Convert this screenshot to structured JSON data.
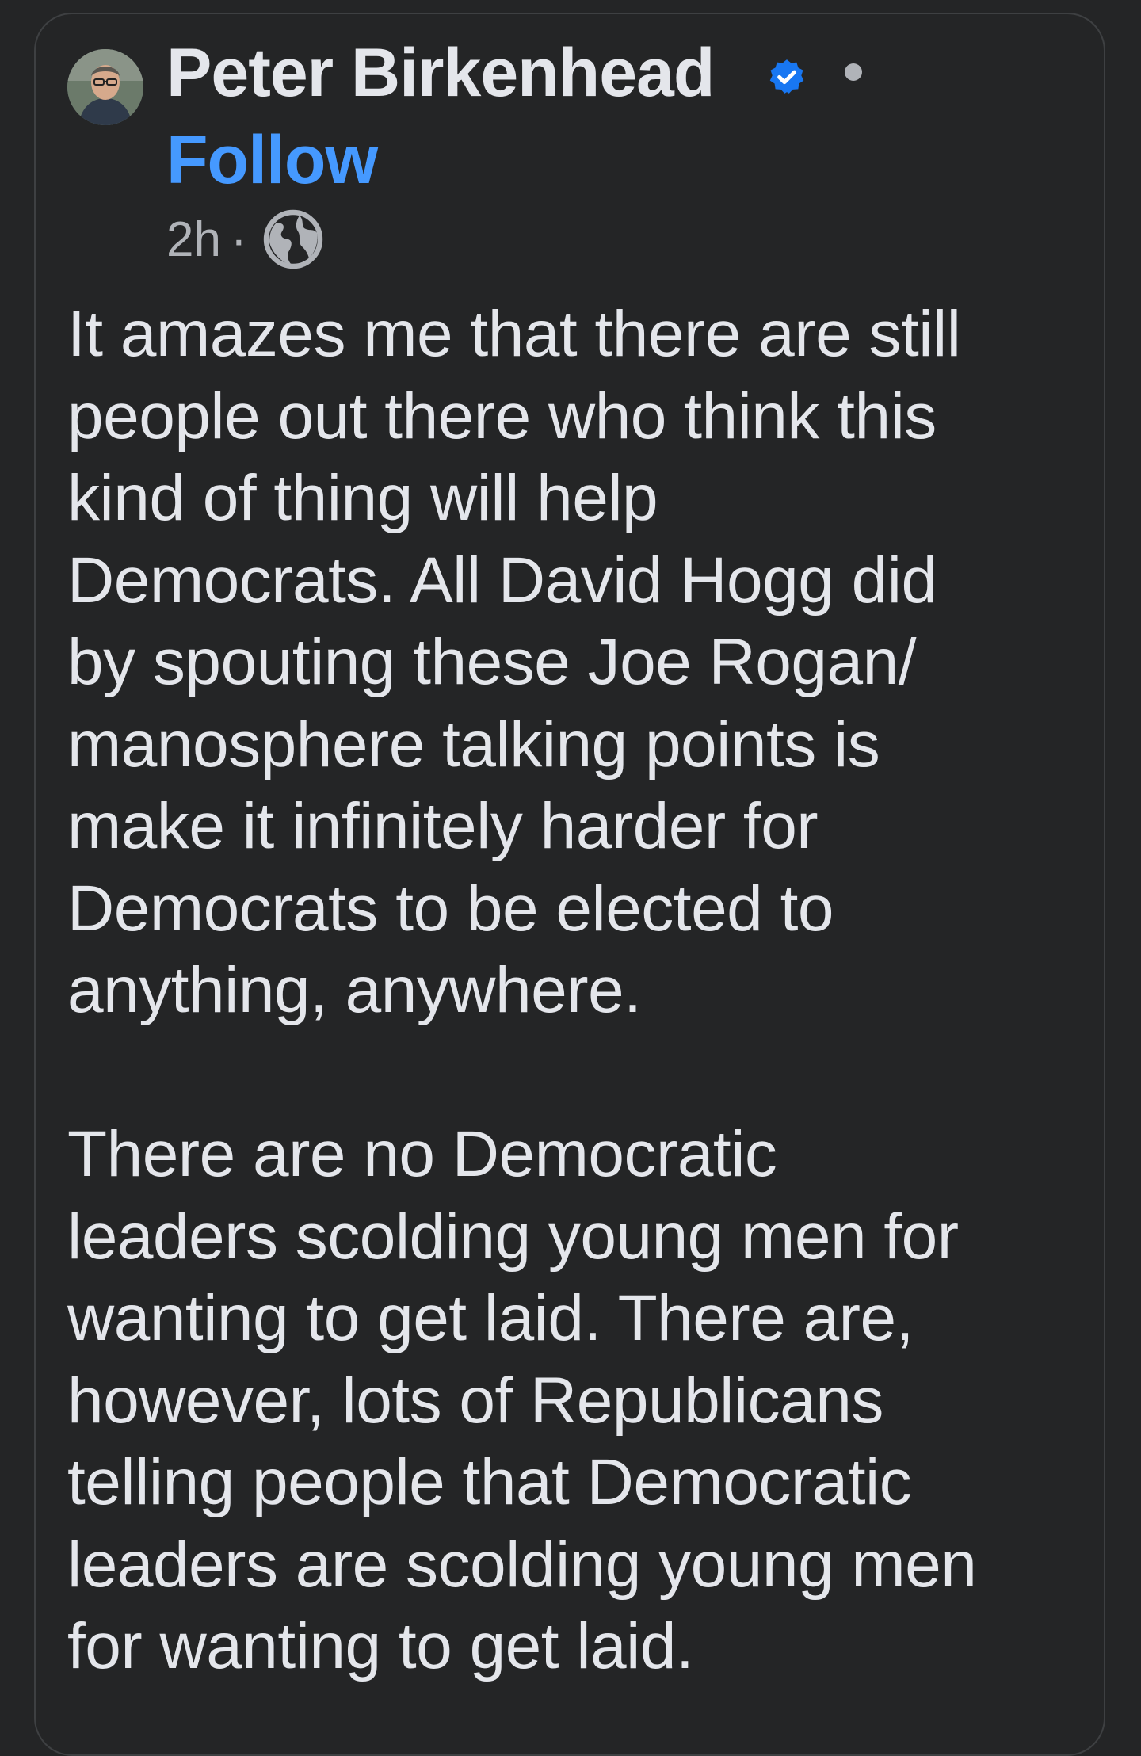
{
  "post": {
    "author": "Peter Birkenhead",
    "follow_label": "Follow",
    "timestamp": "2h",
    "separator": "·",
    "audience_icon": "globe-icon",
    "verified_icon": "verified-badge-icon",
    "paragraphs": [
      "It amazes me that there are still\npeople out there who think this\nkind of thing will help\nDemocrats. All David Hogg did\nby spouting these Joe Rogan/\nmanosphere talking points is\nmake it infinitely harder for\nDemocrats to be elected to\nanything, anywhere.",
      "There are no Democratic\nleaders scolding young men for\nwanting to get laid. There are,\nhowever, lots of Republicans\ntelling people that Democratic\nleaders are scolding young men\nfor wanting to get laid."
    ]
  },
  "colors": {
    "background": "#242526",
    "text": "#e4e6eb",
    "secondary_text": "#b0b3b8",
    "link": "#4599ff",
    "verified": "#1877f2"
  }
}
